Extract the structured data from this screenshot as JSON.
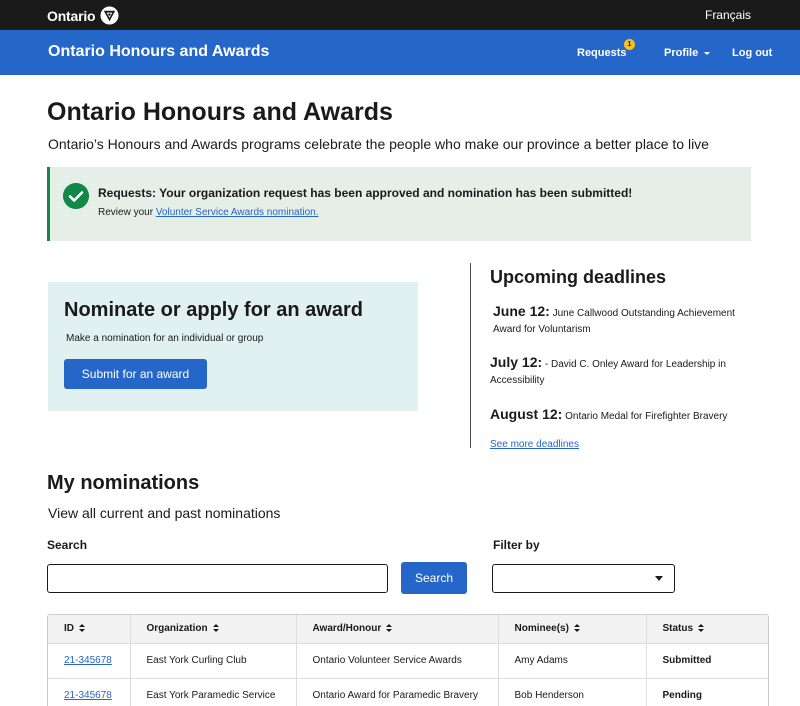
{
  "topbar": {
    "brand": "Ontario",
    "brand_logo_icon": "ontario-trillium-icon",
    "language_link": "Français"
  },
  "header": {
    "app_title": "Ontario Honours and Awards",
    "nav": {
      "requests": "Requests",
      "requests_badge": "1",
      "profile": "Profile",
      "logout": "Log out"
    }
  },
  "page": {
    "title": "Ontario Honours and Awards",
    "subtitle": "Ontario’s Honours and Awards programs celebrate the people who make our province a better place to live"
  },
  "alert": {
    "icon": "checkmark-circle-icon",
    "title": "Requests: Your organization request has been approved and nomination has been submitted!",
    "body_prefix": "Review your ",
    "body_link": "Volunter Service Awards nomination."
  },
  "nominate": {
    "title": "Nominate or apply for an award",
    "text": "Make a nomination for an individual or group",
    "button": "Submit for an award"
  },
  "deadlines": {
    "title": "Upcoming deadlines",
    "items": [
      {
        "date": "June 12:",
        "text": " June Callwood Outstanding Achievement Award for Voluntarism"
      },
      {
        "date": "July 12:",
        "text": " - David C. Onley Award for Leadership in Accessibility"
      },
      {
        "date": "August 12:",
        "text": " Ontario Medal for Firefighter Bravery"
      }
    ],
    "more_link": "See more deadlines"
  },
  "nominations": {
    "title": "My nominations",
    "subtitle": "View all current and past nominations",
    "search_label": "Search",
    "search_value": "",
    "search_button": "Search",
    "filter_label": "Filter by",
    "filter_value": "",
    "table": {
      "headers": [
        "ID",
        "Organization",
        "Award/Honour",
        "Nominee(s)",
        "Status"
      ],
      "rows": [
        [
          "21-345678",
          "East York Curling Club",
          "Ontario Volunteer Service Awards",
          "Amy Adams",
          "Submitted"
        ],
        [
          "21-345678",
          "East York Paramedic Service",
          "Ontario Award for Paramedic Bravery",
          "Bob Henderson",
          "Pending"
        ]
      ]
    }
  },
  "colors": {
    "header_blue": "#2566c9",
    "topbar_black": "#1a1a1a",
    "success_green": "#118847",
    "badge_yellow": "#f5c018"
  }
}
